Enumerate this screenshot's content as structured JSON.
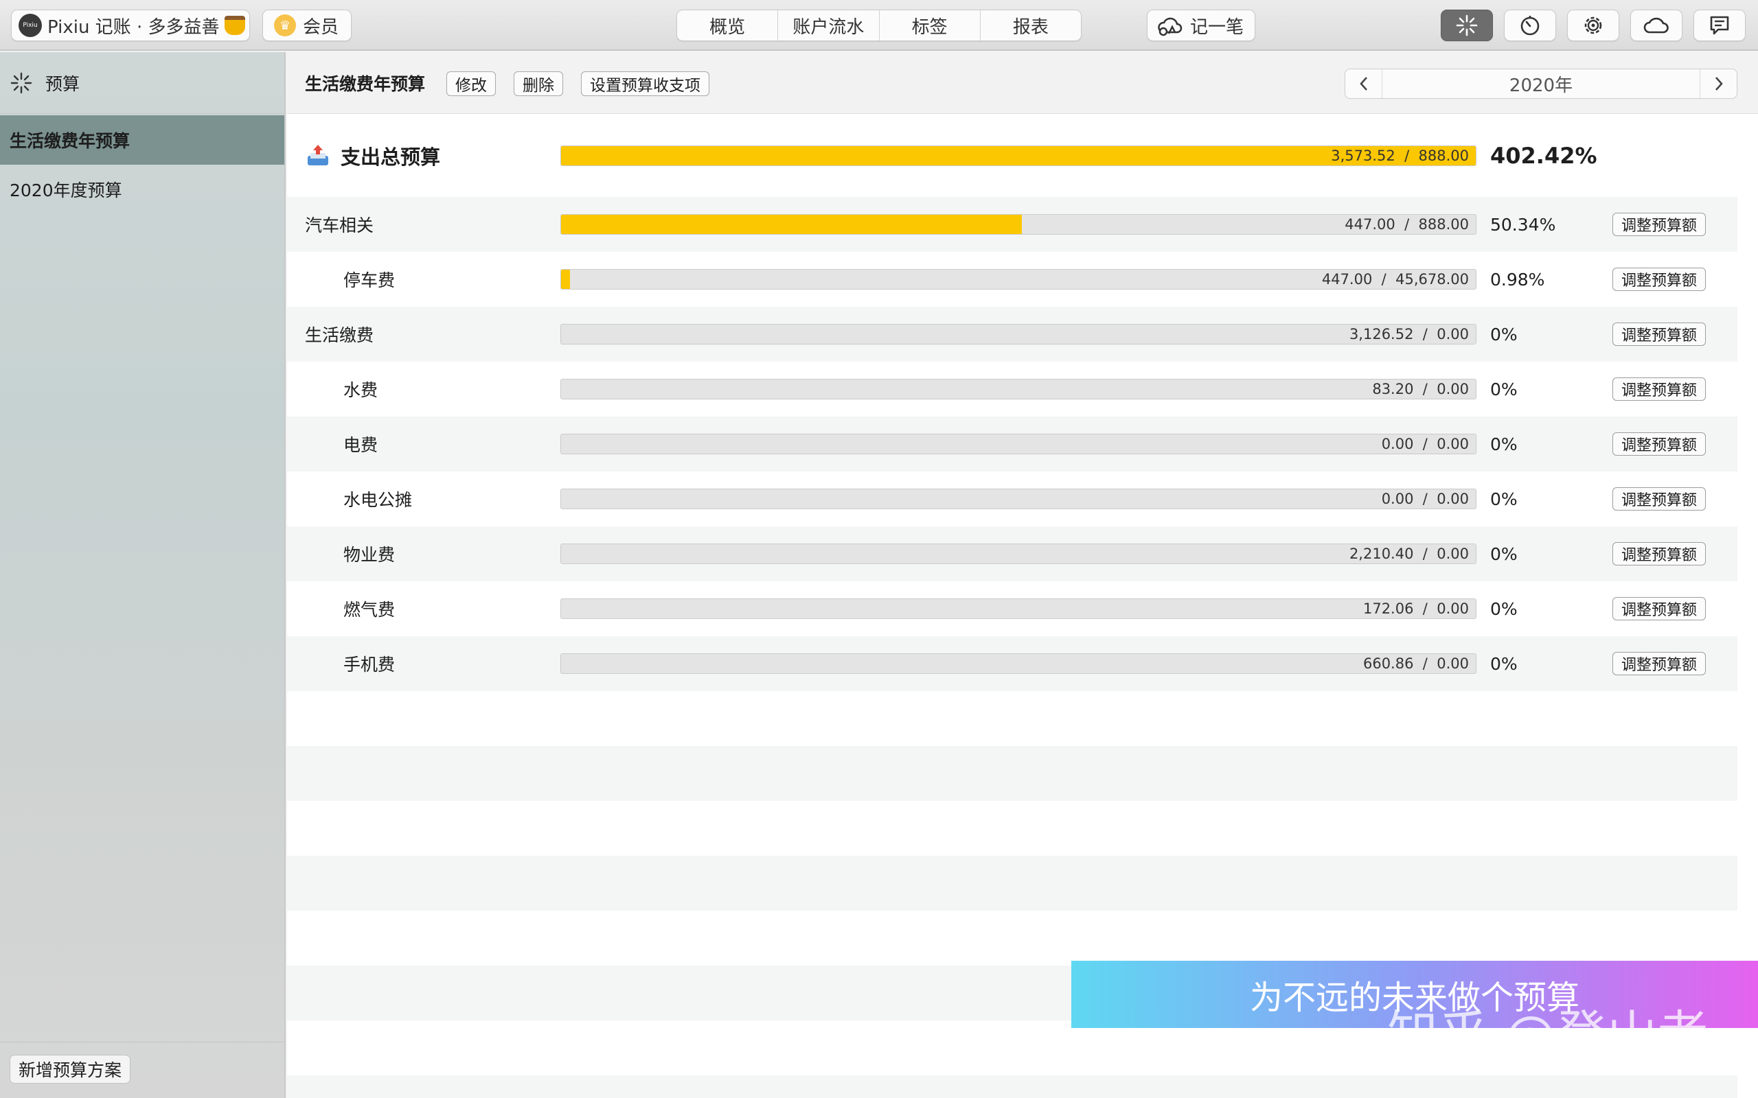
{
  "toolbar": {
    "app_title": "Pixiu 记账 · 多多益善",
    "member_label": "会员",
    "nav_tabs": [
      "概览",
      "账户流水",
      "标签",
      "报表"
    ],
    "record_label": "记一笔",
    "icons": [
      "sparkle-icon",
      "timer-icon",
      "gear-icon",
      "cloud-icon",
      "message-icon"
    ]
  },
  "sidebar": {
    "header": "预算",
    "items": [
      {
        "label": "生活缴费年预算",
        "selected": true
      },
      {
        "label": "2020年度预算",
        "selected": false
      }
    ],
    "add_button": "新增预算方案"
  },
  "main": {
    "plan_title": "生活缴费年预算",
    "edit_label": "修改",
    "delete_label": "删除",
    "set_items_label": "设置预算收支项",
    "year": "2020年",
    "total": {
      "label": "支出总预算",
      "spent": "3,573.52",
      "budget": "888.00",
      "percent": "402.42%",
      "fill": 1.0
    },
    "adjust_label": "调整预算额",
    "rows": [
      {
        "label": "汽车相关",
        "level": 0,
        "spent": "447.00",
        "budget": "888.00",
        "percent": "50.34%",
        "fill": 0.5034
      },
      {
        "label": "停车费",
        "level": 1,
        "spent": "447.00",
        "budget": "45,678.00",
        "percent": "0.98%",
        "fill": 0.0098
      },
      {
        "label": "生活缴费",
        "level": 0,
        "spent": "3,126.52",
        "budget": "0.00",
        "percent": "0%",
        "fill": 0
      },
      {
        "label": "水费",
        "level": 1,
        "spent": "83.20",
        "budget": "0.00",
        "percent": "0%",
        "fill": 0
      },
      {
        "label": "电费",
        "level": 1,
        "spent": "0.00",
        "budget": "0.00",
        "percent": "0%",
        "fill": 0
      },
      {
        "label": "水电公摊",
        "level": 1,
        "spent": "0.00",
        "budget": "0.00",
        "percent": "0%",
        "fill": 0
      },
      {
        "label": "物业费",
        "level": 1,
        "spent": "2,210.40",
        "budget": "0.00",
        "percent": "0%",
        "fill": 0
      },
      {
        "label": "燃气费",
        "level": 1,
        "spent": "172.06",
        "budget": "0.00",
        "percent": "0%",
        "fill": 0
      },
      {
        "label": "手机费",
        "level": 1,
        "spent": "660.86",
        "budget": "0.00",
        "percent": "0%",
        "fill": 0
      }
    ]
  },
  "watermark": {
    "banner_text": "为不远的未来做个预算",
    "credit": "知乎 @登山者"
  },
  "colors": {
    "bar_fill": "#fbc700",
    "selected_item": "#7b9290"
  }
}
